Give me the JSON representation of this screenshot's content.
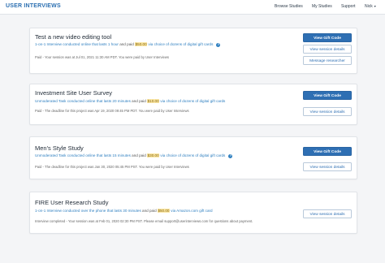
{
  "header": {
    "brand": "USER INTERVIEWS",
    "nav": {
      "browse": "Browse Studies",
      "my_studies": "My Studies",
      "support": "Support",
      "user": "Nick"
    }
  },
  "icons": {
    "help": "question-icon",
    "caret": "chevron-down-icon"
  },
  "colors": {
    "primary": "#2e6fb3",
    "highlight": "#fbe7a6",
    "link": "#2e7fc0"
  },
  "studies": [
    {
      "title": "Test a new video editing tool",
      "sub_link": "1-on-1 Interview conducted online that lasts 1 hour",
      "sub_mid": " and paid ",
      "amount": "$50.00",
      "sub_tail": " via choice of dozens of digital gift cards",
      "note": "Paid - Your session was at Jul 01, 2021 11:30 AM PDT. You were paid by User Interviews",
      "buttons": [
        "View Gift Code",
        "View session details",
        "Message researcher"
      ]
    },
    {
      "title": "Investment Site User Survey",
      "sub_link": "Unmoderated Task conducted online that lasts 20 minutes",
      "sub_mid": " and paid ",
      "amount": "$10.00",
      "sub_tail": " via choice of dozens of digital gift cards",
      "note": "Paid - The deadline for this project was Apr 19, 2020 09:45 PM PDT. You were paid by User Interviews",
      "buttons": [
        "View Gift Code",
        "View session details"
      ]
    },
    {
      "title": "Men's Style Study",
      "sub_link": "Unmoderated Task conducted online that lasts 15 minutes",
      "sub_mid": " and paid ",
      "amount": "$30.00",
      "sub_tail": " via choice of dozens of digital gift cards",
      "note": "Paid - The deadline for this project was Jan 30, 2020 05:45 PM PST. You were paid by User Interviews",
      "buttons": [
        "View Gift Code",
        "View session details"
      ]
    },
    {
      "title": "FIRE User Research Study",
      "sub_link": "1-on-1 Interview conducted over the phone that lasts 30 minutes",
      "sub_mid": " and paid ",
      "amount": "$50.00",
      "sub_tail": " via Amazon.com gift card",
      "note": "Interview completed - Your session was at Feb 01, 2020 02:30 PM PST. Please email support@userinterviews.com for questions about payment.",
      "buttons": [
        "View session details"
      ]
    }
  ]
}
